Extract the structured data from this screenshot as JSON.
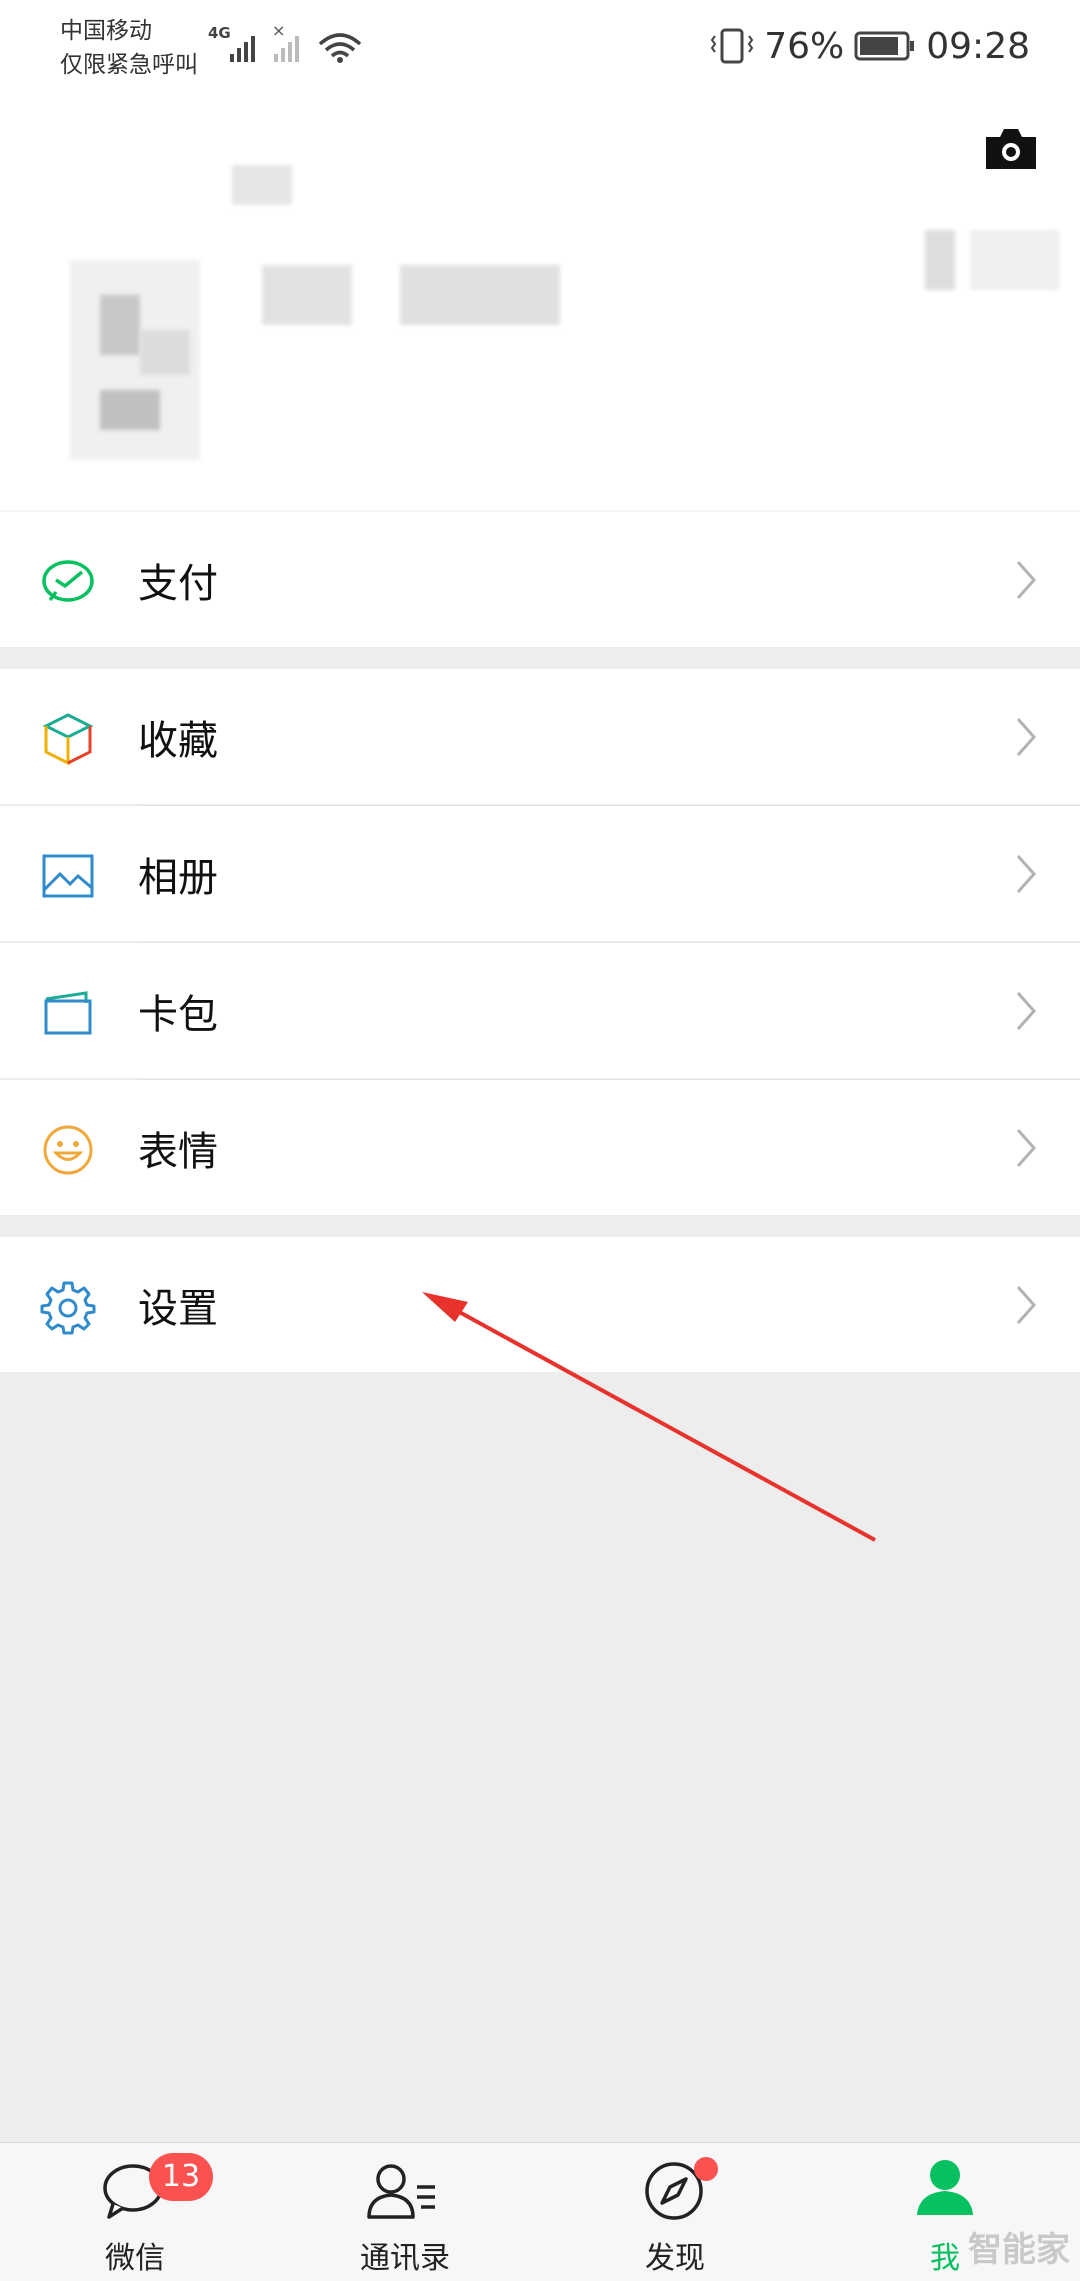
{
  "status_bar": {
    "carrier_line1": "中国移动",
    "carrier_line2": "仅限紧急呼叫",
    "network": "4G",
    "battery": "76%",
    "time": "09:28"
  },
  "menu": {
    "pay": "支付",
    "favorites": "收藏",
    "album": "相册",
    "cards": "卡包",
    "stickers": "表情",
    "settings": "设置"
  },
  "tabbar": {
    "chats": "微信",
    "chats_badge": "13",
    "contacts": "通讯录",
    "discover": "发现",
    "me": "我"
  },
  "colors": {
    "accent": "#07c160",
    "badge": "#fa5151",
    "annotation_arrow": "#e8322b"
  },
  "watermark": "智能家"
}
